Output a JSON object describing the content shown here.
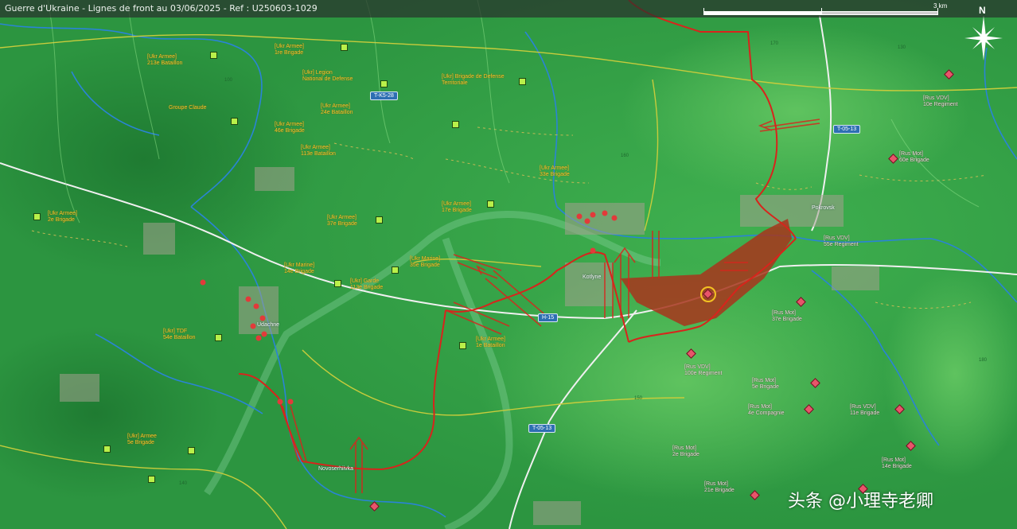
{
  "header": {
    "title": "Guerre d'Ukraine - Lignes de front au 03/06/2025 - Ref : U250603-1029",
    "scale_label": "3 km",
    "compass_label": "N"
  },
  "roads": [
    "T-K5-28",
    "T-05-13",
    "H-15",
    "T-05-13"
  ],
  "units_friendly": [
    "[Ukr Armee]\n1re Brigade",
    "[Ukr Armee]\n213e Bataillon",
    "[Ukr] Legion\nNational de Defense",
    "[Ukr] Brigade de Defense\nTerritoriale",
    "[Ukr Armee]\n24e Bataillon",
    "Groupe Claude",
    "[Ukr Armee]\n46e Brigade",
    "[Ukr Armee]\n113e Bataillon",
    "[Ukr Armee]\n17e Brigade",
    "[Ukr Marine]\n35e Brigade",
    "[Ukr Marine]\n14e Brigade",
    "[Ukr] Garde\n113e Brigade",
    "[Ukr Armee]\n37e Brigade",
    "[Ukr Armee]\n33e Brigade",
    "[Ukr Armee]\n1e Bataillon",
    "[Ukr] TDF\n54e Bataillon",
    "[Ukr] Armee\n5e Brigade",
    "[Ukr Armee]\n2e Brigade"
  ],
  "units_enemy": [
    "[Rus VDV]\n10e Regiment",
    "[Rus Mot]\n60e Brigade",
    "[Rus VDV]\n55e Regiment",
    "[Rus VDV]\n100e Regiment",
    "[Rus Mot]\n5e Brigade",
    "[Rus Mot]\n4e Compagnie",
    "[Rus VDV]\n11e Brigade",
    "[Rus Mot]\n2e Brigade",
    "[Rus Mot]\n21e Brigade",
    "[Rus Mot]\n14e Brigade",
    "[Rus Mot]\n37e Brigade"
  ],
  "places": [
    "Pokrovsk",
    "Kotlyne",
    "Udachne",
    "Novoserhiivka"
  ],
  "contours": [
    "100",
    "130",
    "150",
    "170",
    "180",
    "160",
    "140"
  ],
  "watermark": "头条 @小理寺老卿",
  "colors": {
    "terrain_dark": "#2a8f3d",
    "terrain_light": "#4db657",
    "frontline": "#d8241c",
    "advance_area": "#a8351c",
    "river": "#2a84d6",
    "road_major": "#f0f0f0",
    "road_minor": "#d8b03c",
    "unit_label": "#f2c531"
  }
}
